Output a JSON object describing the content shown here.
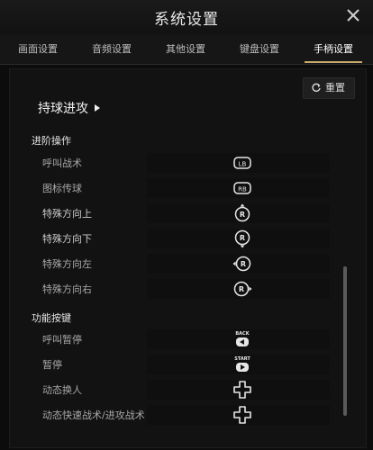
{
  "window": {
    "title": "系统设置"
  },
  "tabs": [
    {
      "label": "画面设置"
    },
    {
      "label": "音频设置"
    },
    {
      "label": "其他设置"
    },
    {
      "label": "键盘设置"
    },
    {
      "label": "手柄设置",
      "active": true
    }
  ],
  "toolbar": {
    "reset_label": "重置"
  },
  "main": {
    "group_title": "持球进攻",
    "sections": [
      {
        "title": "进阶操作",
        "rows": [
          {
            "label": "呼叫战术",
            "key_icon": "lb-button-icon",
            "key_text": "LB"
          },
          {
            "label": "图标传球",
            "key_icon": "rb-button-icon",
            "key_text": "RB"
          },
          {
            "label": "特殊方向上",
            "key_icon": "right-stick-up-icon",
            "key_text": "R"
          },
          {
            "label": "特殊方向下",
            "key_icon": "right-stick-down-icon",
            "key_text": "R"
          },
          {
            "label": "特殊方向左",
            "key_icon": "right-stick-left-icon",
            "key_text": "R"
          },
          {
            "label": "特殊方向右",
            "key_icon": "right-stick-right-icon",
            "key_text": "R"
          }
        ]
      },
      {
        "title": "功能按键",
        "rows": [
          {
            "label": "呼叫暂停",
            "key_icon": "back-button-icon",
            "key_text": "BACK"
          },
          {
            "label": "暂停",
            "key_icon": "start-button-icon",
            "key_text": "START"
          },
          {
            "label": "动态换人",
            "key_icon": "dpad-icon",
            "key_text": ""
          },
          {
            "label": "动态快速战术/进攻战术",
            "key_icon": "dpad-icon",
            "key_text": ""
          }
        ]
      }
    ]
  },
  "colors": {
    "accent": "#c9a96e",
    "background": "#0c0c0c",
    "panel": "#121212"
  }
}
